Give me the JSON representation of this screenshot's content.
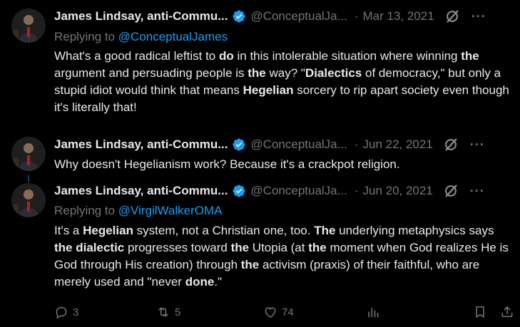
{
  "tweets": [
    {
      "author": "James Lindsay, anti-Commu...",
      "handle": "@ConceptualJa...",
      "date": "Mar 13, 2021",
      "replying_prefix": "Replying to ",
      "replying_to": "@ConceptualJames",
      "body": [
        {
          "t": "What's a good radical leftist to ",
          "b": false
        },
        {
          "t": "do",
          "b": true
        },
        {
          "t": " in this intolerable situation where winning ",
          "b": false
        },
        {
          "t": "the",
          "b": true
        },
        {
          "t": " argument and persuading people is ",
          "b": false
        },
        {
          "t": "the",
          "b": true
        },
        {
          "t": " way? \"",
          "b": false
        },
        {
          "t": "Dialectics",
          "b": true
        },
        {
          "t": " of democracy,\" but only a stupid idiot would think that means ",
          "b": false
        },
        {
          "t": "Hegelian",
          "b": true
        },
        {
          "t": " sorcery to rip apart society even though it's literally that!",
          "b": false
        }
      ]
    },
    {
      "author": "James Lindsay, anti-Commu...",
      "handle": "@ConceptualJa...",
      "date": "Jun 22, 2021",
      "body": [
        {
          "t": "Why doesn't Hegelianism work? Because it's a crackpot religion.",
          "b": false
        }
      ]
    },
    {
      "author": "James Lindsay, anti-Commu...",
      "handle": "@ConceptualJa...",
      "date": "Jun 20, 2021",
      "replying_prefix": "Replying to ",
      "replying_to": "@VirgilWalkerOMA",
      "body": [
        {
          "t": "It's a ",
          "b": false
        },
        {
          "t": "Hegelian",
          "b": true
        },
        {
          "t": " system, not a Christian one, too. ",
          "b": false
        },
        {
          "t": "The",
          "b": true
        },
        {
          "t": " underlying metaphysics says ",
          "b": false
        },
        {
          "t": "the dialectic",
          "b": true
        },
        {
          "t": " progresses toward ",
          "b": false
        },
        {
          "t": "the",
          "b": true
        },
        {
          "t": " Utopia (at ",
          "b": false
        },
        {
          "t": "the",
          "b": true
        },
        {
          "t": " moment when God realizes He is God through His creation) through ",
          "b": false
        },
        {
          "t": "the",
          "b": true
        },
        {
          "t": " activism (praxis) of their faithful, who are merely used and \"never ",
          "b": false
        },
        {
          "t": "done",
          "b": true
        },
        {
          "t": ".\"",
          "b": false
        }
      ]
    }
  ],
  "actions": {
    "replies": "3",
    "reposts": "5",
    "likes": "74"
  },
  "icons": {
    "verified": "verified-badge-icon",
    "grok": "grok-icon",
    "more": "more-icon",
    "reply": "reply-icon",
    "repost": "repost-icon",
    "like": "like-icon",
    "views": "views-icon",
    "bookmark": "bookmark-icon",
    "share": "share-icon"
  },
  "colors": {
    "background": "#000000",
    "text": "#e7e9ea",
    "muted": "#71767b",
    "link": "#1d9bf0",
    "verified": "#1d9bf0"
  },
  "more_label": "···"
}
